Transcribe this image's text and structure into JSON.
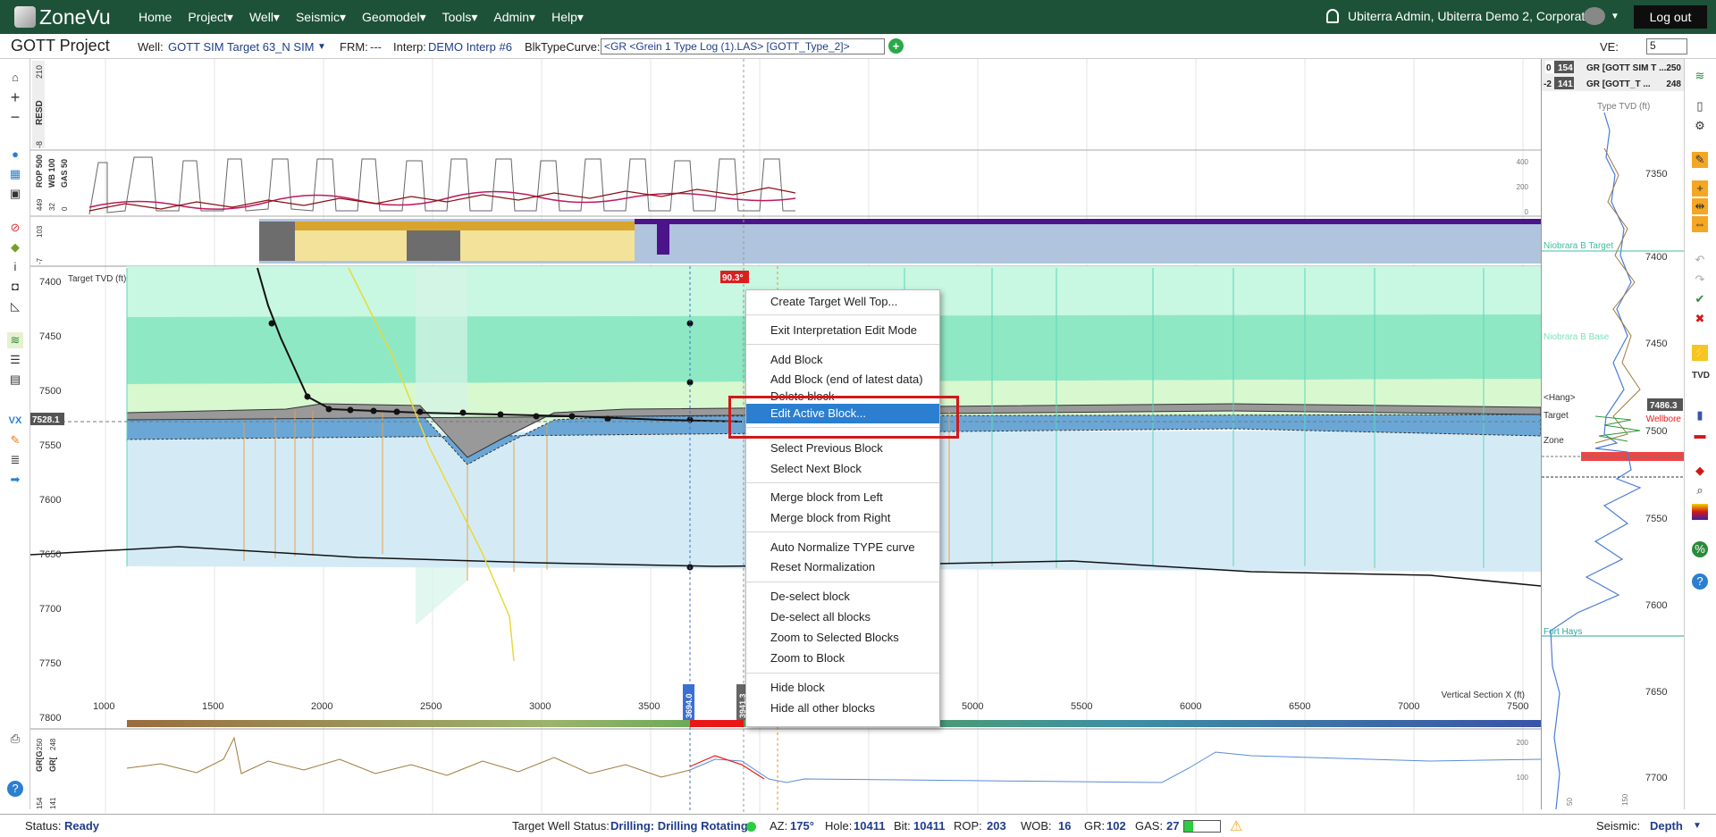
{
  "nav": {
    "logo": "ZoneVu",
    "menu": [
      "Home",
      "Project▾",
      "Well▾",
      "Seismic▾",
      "Geomodel▾",
      "Tools▾",
      "Admin▾",
      "Help▾"
    ],
    "user": "Ubiterra Admin, Ubiterra Demo 2, Corporate",
    "logout": "Log out"
  },
  "toolbar": {
    "project": "GOTT Project",
    "well_label": "Well:",
    "well_value": "GOTT SIM Target 63_N SIM",
    "frm_label": "FRM:",
    "frm_value": "---",
    "interp_label": "Interp:",
    "interp_value": "DEMO Interp #6",
    "blk_label": "BlkTypeCurve:",
    "blk_value": "<GR <Grein 1 Type Log (1).LAS> [GOTT_Type_2]>",
    "ve_label": "VE:",
    "ve_value": "5"
  },
  "tracks": {
    "resd_label": "RESD",
    "resd_top": "210",
    "resd_bottom": "-8",
    "gas_label": "GAS 50",
    "rop_label": "ROP 500",
    "wb_label": "WB 100",
    "tracks_vals": [
      "449",
      "0",
      "32"
    ],
    "gas_right_ticks": [
      "400",
      "200",
      "0"
    ],
    "strip_label": "103",
    "strip_label2": "-7",
    "gr_labels": [
      "GR[G",
      "GR[",
      "250",
      "248"
    ],
    "gr_values": [
      "154",
      "141"
    ],
    "gr_right_ticks": [
      "200",
      "100"
    ]
  },
  "main": {
    "title": "Target TVD (ft)",
    "y_ticks": [
      "7400",
      "7450",
      "7500",
      "7550",
      "7600",
      "7650",
      "7700",
      "7750",
      "7800"
    ],
    "x_ticks": [
      "1000",
      "1500",
      "2000",
      "2500",
      "3000",
      "3500",
      "5000",
      "5500",
      "6000",
      "6500",
      "7000",
      "7500"
    ],
    "x_axis_label": "Vertical Section X (ft)",
    "cursor_tvd": "7528.1",
    "angle_badge": "90.3°",
    "marker_a": "3694.0",
    "marker_b": "3941.3"
  },
  "context_menu": {
    "items": [
      "Create Target Well Top...",
      "Exit Interpretation Edit Mode",
      "Add Block",
      "Add Block (end of latest data)",
      "Delete block",
      "Edit Active Block...",
      "Select Previous Block",
      "Select Next Block",
      "Merge block from Left",
      "Merge block from Right",
      "Auto Normalize TYPE curve",
      "Reset Normalization",
      "De-select block",
      "De-select all blocks",
      "Zoom to Selected Blocks",
      "Zoom to Block",
      "Hide block",
      "Hide all other blocks"
    ]
  },
  "typelog": {
    "header1_a": "0",
    "header1_b": "154",
    "header1_name": "GR [GOTT SIM T ...",
    "header1_max": "250",
    "header2_a": "-2",
    "header2_b": "141",
    "header2_name": "GR [GOTT_T ...",
    "header2_max": "248",
    "title": "Type TVD (ft)",
    "ticks": [
      "7350",
      "7400",
      "7450",
      "7500",
      "7550",
      "7600",
      "7650",
      "7700"
    ],
    "tops": [
      "Niobrara B Target",
      "Niobrara B Base",
      "<Hang>",
      "Target",
      "Zone",
      "Fort Hays"
    ],
    "wellbore": "Wellbore",
    "badge": "7486.3",
    "bottom_ticks": [
      "50",
      "150"
    ]
  },
  "status": {
    "status_label": "Status:",
    "status_value": "Ready",
    "tws_label": "Target Well Status:",
    "tws_value": "Drilling: Drilling Rotating",
    "az_label": "AZ:",
    "az_value": "175°",
    "hole_label": "Hole:",
    "hole_value": "10411",
    "bit_label": "Bit:",
    "bit_value": "10411",
    "rop_label": "ROP:",
    "rop_value": "203",
    "wob_label": "WOB:",
    "wob_value": "16",
    "gr_label": "GR:",
    "gr_value": "102",
    "gas_label": "GAS:",
    "gas_value": "27",
    "seismic_label": "Seismic:",
    "seismic_value": "Depth"
  },
  "colors": {
    "nav": "#1d5238",
    "accent": "#2c7fd0",
    "highlight_box": "#d11818",
    "band_green": "#bff3d5",
    "block_blue": "#6aa7d6"
  }
}
